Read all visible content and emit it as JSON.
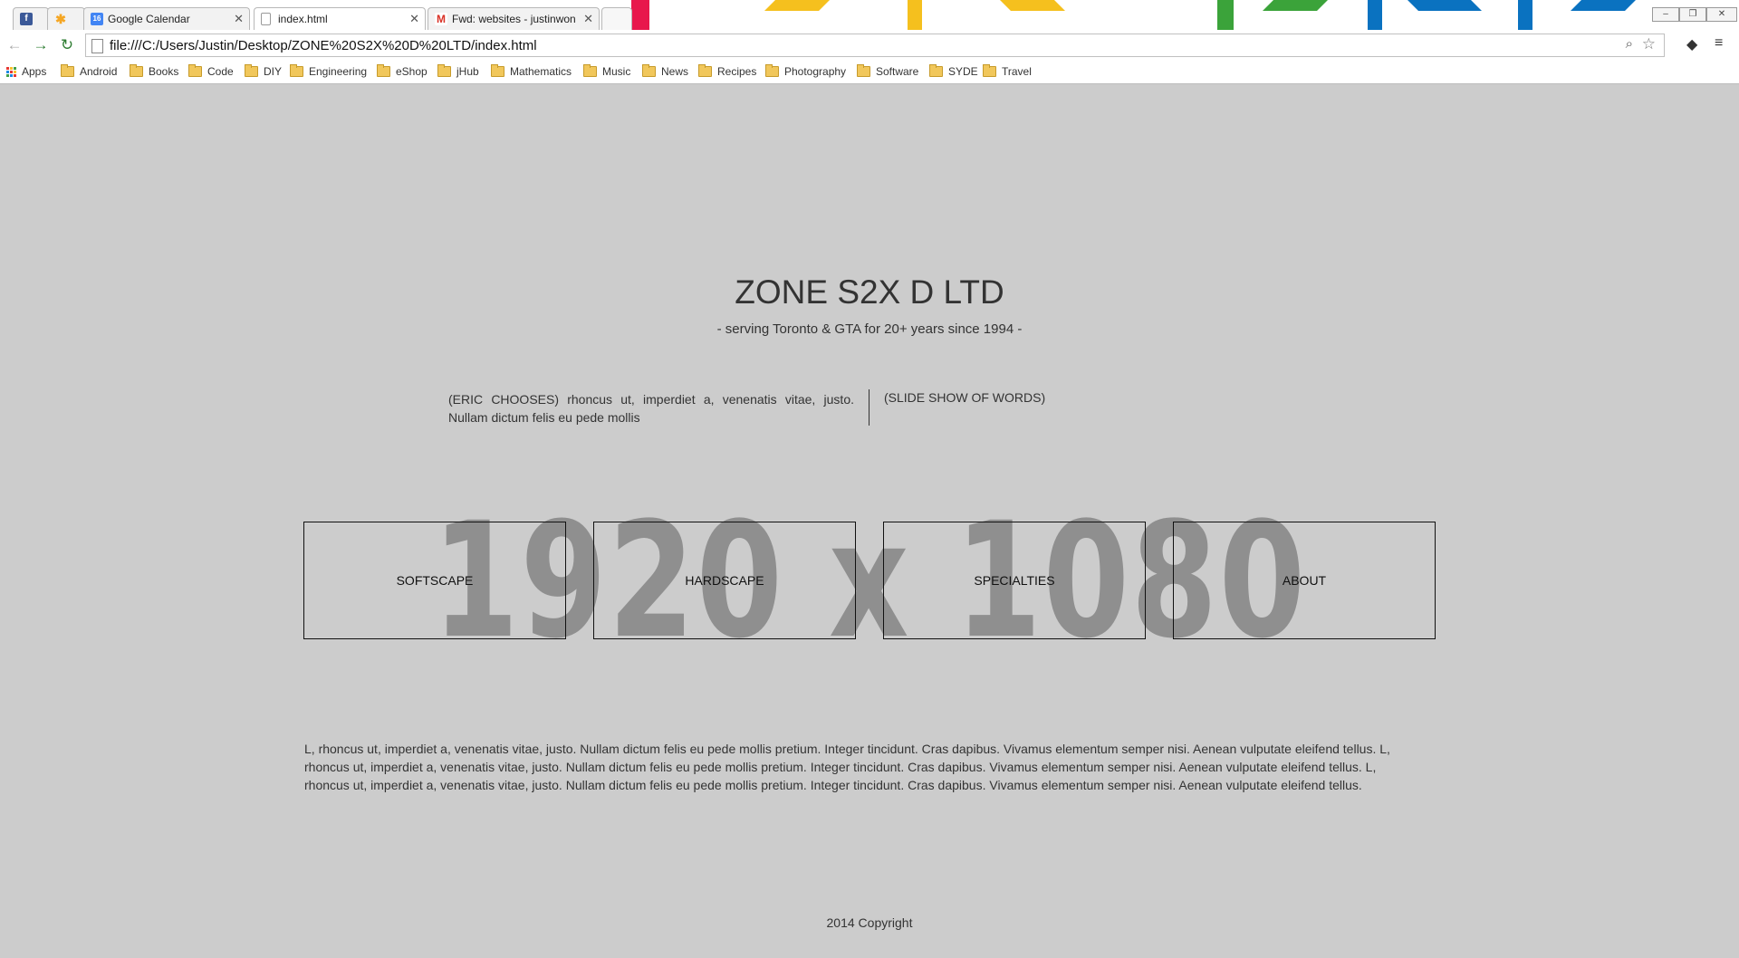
{
  "browser": {
    "tabs": [
      {
        "title": "",
        "favicon": "facebook-icon",
        "color": "#3b5998"
      },
      {
        "title": "",
        "favicon": "asterisk-icon",
        "color": "#f5a623"
      },
      {
        "title": "Google Calendar",
        "favicon": "calendar-icon",
        "favicon_text": "16",
        "color": "#4285f4"
      },
      {
        "title": "index.html",
        "favicon": "page-icon",
        "color": "#ffffff"
      },
      {
        "title": "Fwd: websites - justinwon",
        "favicon": "gmail-icon",
        "color": "#d93025"
      }
    ],
    "url": "file:///C:/Users/Justin/Desktop/ZONE%20S2X%20D%20LTD/index.html",
    "bookmarks_apps": "Apps",
    "bookmarks": [
      "Android",
      "Books",
      "Code",
      "DIY",
      "Engineering",
      "eShop",
      "jHub",
      "Mathematics",
      "Music",
      "News",
      "Recipes",
      "Photography",
      "Software",
      "SYDE",
      "Travel"
    ]
  },
  "site": {
    "title": "ZONE S2X D LTD",
    "subtitle": "- serving Toronto & GTA for 20+ years since 1994 -",
    "intro_left": "(ERIC CHOOSES) rhoncus ut, imperdiet a, venenatis vitae, justo. Nullam dictum felis eu pede mollis",
    "intro_right": "(SLIDE SHOW OF WORDS)",
    "nav": [
      "SOFTSCAPE",
      "HARDSCAPE",
      "SPECIALTIES",
      "ABOUT"
    ],
    "resolution_overlay": "1920 x 1080",
    "body_text": "L, rhoncus ut, imperdiet a, venenatis vitae, justo. Nullam dictum felis eu pede mollis pretium. Integer tincidunt. Cras dapibus. Vivamus elementum semper nisi. Aenean vulputate eleifend tellus. L, rhoncus ut, imperdiet a, venenatis vitae, justo. Nullam dictum felis eu pede mollis pretium. Integer tincidunt. Cras dapibus. Vivamus elementum semper nisi. Aenean vulputate eleifend tellus. L, rhoncus ut, imperdiet a, venenatis vitae, justo. Nullam dictum felis eu pede mollis pretium. Integer tincidunt. Cras dapibus. Vivamus elementum semper nisi. Aenean vulputate eleifend tellus.",
    "copyright": "2014 Copyright"
  },
  "colors": {
    "page_background": "#cccccc",
    "text": "#333333",
    "overlay_text": "#8f8f8f"
  }
}
